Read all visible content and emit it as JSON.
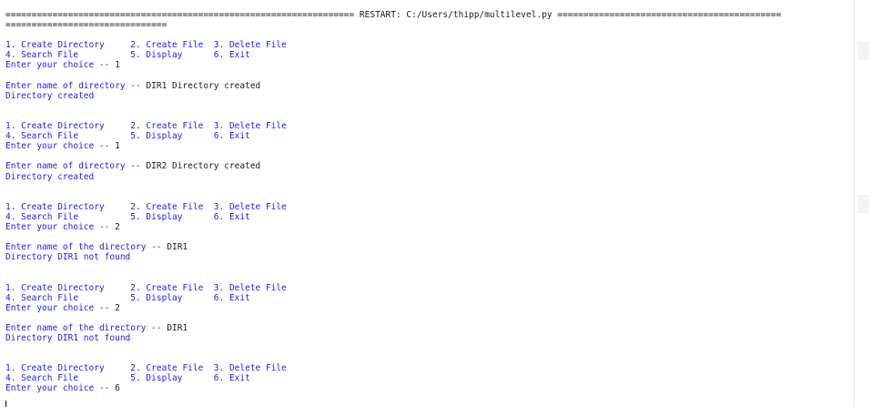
{
  "shell": {
    "restart_line": "=================================================================== RESTART: C:/Users/thipp/multilevel.py ===========================================",
    "restart_cont": "==============================="
  },
  "lines": [
    {
      "blank": true
    },
    {
      "parts": [
        {
          "t": "1. Create Directory     2. Create File  3. Delete File",
          "c": "out"
        }
      ]
    },
    {
      "parts": [
        {
          "t": "4. Search File          5. Display      6. Exit",
          "c": "out"
        }
      ]
    },
    {
      "parts": [
        {
          "t": "Enter your choice -- ",
          "c": "out"
        },
        {
          "t": "1",
          "c": "inp"
        }
      ]
    },
    {
      "blank": true
    },
    {
      "parts": [
        {
          "t": "Enter name of directory -- ",
          "c": "out"
        },
        {
          "t": "DIR1 Directory created",
          "c": "inp"
        }
      ]
    },
    {
      "parts": [
        {
          "t": "Directory created",
          "c": "out"
        }
      ]
    },
    {
      "blank": true
    },
    {
      "blank": true
    },
    {
      "parts": [
        {
          "t": "1. Create Directory     2. Create File  3. Delete File",
          "c": "out"
        }
      ]
    },
    {
      "parts": [
        {
          "t": "4. Search File          5. Display      6. Exit",
          "c": "out"
        }
      ]
    },
    {
      "parts": [
        {
          "t": "Enter your choice -- ",
          "c": "out"
        },
        {
          "t": "1",
          "c": "inp"
        }
      ]
    },
    {
      "blank": true
    },
    {
      "parts": [
        {
          "t": "Enter name of directory -- ",
          "c": "out"
        },
        {
          "t": "DIR2 Directory created",
          "c": "inp"
        }
      ]
    },
    {
      "parts": [
        {
          "t": "Directory created",
          "c": "out"
        }
      ]
    },
    {
      "blank": true
    },
    {
      "blank": true
    },
    {
      "parts": [
        {
          "t": "1. Create Directory     2. Create File  3. Delete File",
          "c": "out"
        }
      ]
    },
    {
      "parts": [
        {
          "t": "4. Search File          5. Display      6. Exit",
          "c": "out"
        }
      ]
    },
    {
      "parts": [
        {
          "t": "Enter your choice -- ",
          "c": "out"
        },
        {
          "t": "2",
          "c": "inp"
        }
      ]
    },
    {
      "blank": true
    },
    {
      "parts": [
        {
          "t": "Enter name of the directory -- ",
          "c": "out"
        },
        {
          "t": "DIR1",
          "c": "inp"
        }
      ]
    },
    {
      "parts": [
        {
          "t": "Directory DIR1 not found",
          "c": "out"
        }
      ]
    },
    {
      "blank": true
    },
    {
      "blank": true
    },
    {
      "parts": [
        {
          "t": "1. Create Directory     2. Create File  3. Delete File",
          "c": "out"
        }
      ]
    },
    {
      "parts": [
        {
          "t": "4. Search File          5. Display      6. Exit",
          "c": "out"
        }
      ]
    },
    {
      "parts": [
        {
          "t": "Enter your choice -- ",
          "c": "out"
        },
        {
          "t": "2",
          "c": "inp"
        }
      ]
    },
    {
      "blank": true
    },
    {
      "parts": [
        {
          "t": "Enter name of the directory -- ",
          "c": "out"
        },
        {
          "t": "DIR1",
          "c": "inp"
        }
      ]
    },
    {
      "parts": [
        {
          "t": "Directory DIR1 not found",
          "c": "out"
        }
      ]
    },
    {
      "blank": true
    },
    {
      "blank": true
    },
    {
      "parts": [
        {
          "t": "1. Create Directory     2. Create File  3. Delete File",
          "c": "out"
        }
      ]
    },
    {
      "parts": [
        {
          "t": "4. Search File          5. Display      6. Exit",
          "c": "out"
        }
      ]
    },
    {
      "parts": [
        {
          "t": "Enter your choice -- ",
          "c": "out"
        },
        {
          "t": "6",
          "c": "inp"
        }
      ]
    }
  ],
  "colors": {
    "output": "#1a1aff",
    "input": "#1a1a1a",
    "background": "#ffffff"
  }
}
